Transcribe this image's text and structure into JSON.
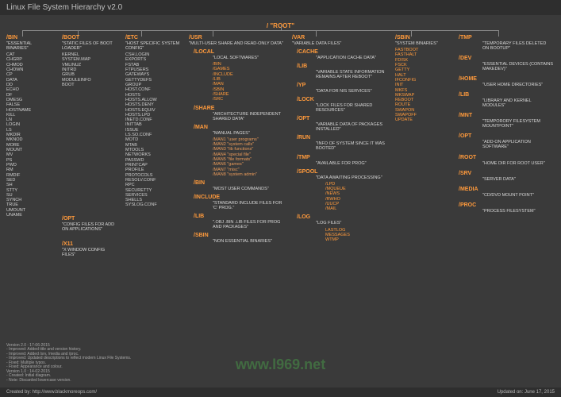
{
  "title": "Linux File System Hierarchy v2.0",
  "root": {
    "label": "/ \"ROOT\""
  },
  "bin": {
    "dir": "/BIN",
    "desc": "\"ESSENTIAL BINARIES\"",
    "items": [
      "CAT",
      "CHGRP",
      "CHMOD",
      "CHOWN",
      "CP",
      "DATA",
      "DD",
      "ECHO",
      "DF",
      "DMESG",
      "FALSE",
      "HOSTNAME",
      "KILL",
      "LN",
      "LOGIN",
      "LS",
      "MKDIR",
      "MKNOD",
      "MORE",
      "MOUNT",
      "MV",
      "PS",
      "PWD",
      "RM",
      "RMDIF",
      "SED",
      "SH",
      "STTY",
      "SU",
      "SYNCH",
      "TRUE",
      "UMOUNT",
      "UNAME"
    ]
  },
  "boot": {
    "dir": "/BOOT",
    "desc": "\"STATIC FILES OF BOOT LOADER\"",
    "items": [
      "KERNEL",
      "SYSTEM.MAP",
      "VMLINUZ",
      "INITRD",
      "GRUB",
      "MODULEINFO",
      "BOOT"
    ]
  },
  "opt": {
    "dir": "/OPT",
    "desc": "\"CONFIG FILES FOR ADD ON APPLICATIONS\""
  },
  "x11": {
    "dir": "/X11",
    "desc": "\"X WINDOW CONFIG FILES\""
  },
  "etc": {
    "dir": "/ETC",
    "desc": "\"HOST SPECIFIC SYSTEM CONFIG\"",
    "items": [
      "CSH.LOGIN",
      "EXPORTS",
      "FSTAB",
      "FTPUSERS",
      "GATEWAYS",
      "GETTYDEFS",
      "GROUP",
      "HOST.CONF",
      "HOSTS",
      "HOSTS.ALLOW",
      "HOSTS.DENY",
      "HOSTS.EQUIV",
      "HOSTS.LPD",
      "INETD.CONF",
      "INITTAB",
      "ISSUE",
      "LS.SO.CONF",
      "MOTD",
      "MTAB",
      "MTOOLS",
      "NETWORKS",
      "PASSWD",
      "PRINTCAP",
      "PROFILE",
      "PROTOCOLS",
      "RESOLV.CONF",
      "RPC",
      "SECURETTY",
      "SERVICES",
      "SHELLS",
      "SYSLOG.CONF"
    ]
  },
  "usr": {
    "dir": "/USR",
    "desc": "\"MULTI-USER SHARE AND READ-ONLY DATA\"",
    "local": {
      "dir": "/LOCAL",
      "desc": "\"LOCAL SOFTWARES\"",
      "items": [
        "/BIN",
        "/GAMES",
        "/INCLUDE",
        "/LIB",
        "/MAN",
        "/SBIN",
        "/SHARE",
        "/SRC"
      ]
    },
    "share": {
      "dir": "/SHARE",
      "desc": "\"ARCHITECTURE INDEPENDENT SHARED DATA\""
    },
    "man": {
      "dir": "/MAN",
      "desc": "\"MANUAL PAGES\"",
      "items": [
        "/MAN1 \"user programs\"",
        "/MAN2 \"system calls\"",
        "/MAN3 \"lib functions\"",
        "/MAN4 \"special file\"",
        "/MAN5 \"file formats\"",
        "/MAN6 \"games\"",
        "/MAN7 \"misc\"",
        "/MAN8 \"system admin\""
      ]
    },
    "bin2": {
      "dir": "/BIN",
      "desc": "\"MOST USER COMMANDS\""
    },
    "include": {
      "dir": "/INCLUDE",
      "desc": "\"STANDARD INCLUDE FILES FOR 'C' PROG.\""
    },
    "lib2": {
      "dir": "/LIB",
      "desc": "\".OBJ .BIN .LIB FILES FOR PROG AND PACKAGES\""
    },
    "sbin2": {
      "dir": "/SBIN",
      "desc": "\"NON ESSENTIAL BINARIES\""
    }
  },
  "var": {
    "dir": "/VAR",
    "desc": "\"VARIABLE DATA FILES\"",
    "cache": {
      "dir": "/CACHE",
      "desc": "\"APPLICATION CACHE DATA\""
    },
    "lib": {
      "dir": "/LIB",
      "desc": "\"VARIABLE STATE INFORMATION REMAINS AFTER REBOOT\""
    },
    "yp": {
      "dir": "/YP",
      "desc": "\"DATA FOR NIS SERVICES\""
    },
    "lock": {
      "dir": "/LOCK",
      "desc": "\"LOCK FILES FOR SHARED RESOURCES\""
    },
    "opt": {
      "dir": "/OPT",
      "desc": "\"VARIABLE DATA OF PACKAGES INSTALLED\""
    },
    "run": {
      "dir": "/RUN",
      "desc": "\"INFO OF SYSTEM SINCE IT WAS BOOTED\""
    },
    "tmp": {
      "dir": "/TMP",
      "desc": "\"AVAILABLE FOR PROG\""
    },
    "spool": {
      "dir": "/SPOOL",
      "desc": "\"DATA AWAITING PROCESSING\"",
      "items": [
        "/LPD",
        "/MQUEUE",
        "/NEWS",
        "/RWHO",
        "/UUCP",
        "/MAIL"
      ]
    },
    "log": {
      "dir": "/LOG",
      "desc": "\"LOG FILES\"",
      "items": [
        "LASTLOG",
        "MESSAGES",
        "WTMP"
      ]
    }
  },
  "sbin": {
    "dir": "/SBIN",
    "desc": "\"SYSTEM BINARIES\"",
    "items": [
      "FASTBOOT",
      "FASTHALT",
      "FDISK",
      "FSCK",
      "GETTY",
      "HALT",
      "IFCONFIG",
      "INIT",
      "MKFS",
      "MKSWAP",
      "REBOOT",
      "ROUTE",
      "SWAPON",
      "SWAPOFF",
      "UPDATE"
    ]
  },
  "rightcol": {
    "tmp": {
      "dir": "/TMP",
      "desc": "\"TEMPORARY FILES DELETED ON BOOTUP\""
    },
    "dev": {
      "dir": "/DEV",
      "desc": "\"ESSENTIAL DEVICES (CONTAINS MAKEDEV)\""
    },
    "home": {
      "dir": "/HOME",
      "desc": "\"USER HOME DIRECTORIES\""
    },
    "lib": {
      "dir": "/LIB",
      "desc": "\"LIBRARY AND KERNEL MODULES\""
    },
    "mnt": {
      "dir": "/MNT",
      "desc": "\"TEMPORORY FILESYSTEM MOUNTPOINT\""
    },
    "opt": {
      "dir": "/OPT",
      "desc": "\"ADD-ON APPLICATION SOFTWARE\""
    },
    "root": {
      "dir": "/ROOT",
      "desc": "\"HOME DIR FOR ROOT USER\""
    },
    "srv": {
      "dir": "/SRV",
      "desc": "\"SERVER DATA\""
    },
    "media": {
      "dir": "/MEDIA",
      "desc": "\"CD/DVD MOUNT POINT\""
    },
    "proc": {
      "dir": "/PROC",
      "desc": "\"PROCESS FILESYSTEM\""
    }
  },
  "version_notes": {
    "v20": "Version 2.0 : 17-06-2015",
    "v20_a": "- Improved: Added title and version history.",
    "v20_b": "- Improved: Added /srv, /media and /proc.",
    "v20_c": "- Improved: Updated descriptions to reflect modern Linux File Systems.",
    "v20_d": "- Fixed: Multiple typos.",
    "v20_e": "- Fixed: Appearance and colour.",
    "v10": "Version 1.0 : 14-02-2015",
    "v10_a": "- Created: Initial diagram.",
    "v10_b": "- Note: Discarded lowercase version."
  },
  "footer": {
    "left": "Created by: http://www.blackmoreops.com/",
    "right": "Updated on: June 17, 2015"
  },
  "watermark": "www.l969.net"
}
